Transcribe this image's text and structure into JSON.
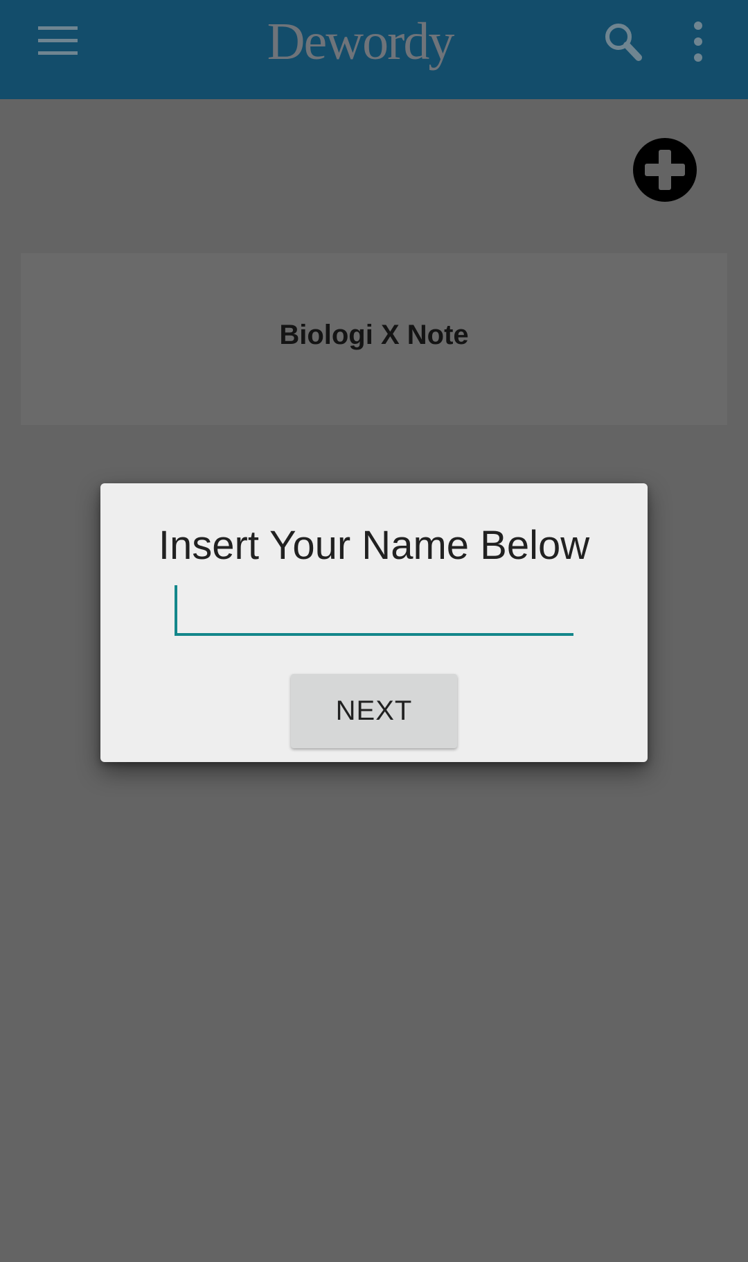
{
  "app_bar": {
    "logo_text": "Dewordy",
    "menu_icon": "hamburger-menu-icon",
    "search_icon": "search-icon",
    "more_icon": "more-vertical-icon",
    "background_color": "#134d6b"
  },
  "main": {
    "add_icon": "add-circle-icon",
    "notes": [
      {
        "title": "Biologi X Note"
      }
    ]
  },
  "dialog": {
    "title": "Insert Your Name Below",
    "input_value": "",
    "next_label": "NEXT",
    "accent_color": "#13868a"
  }
}
